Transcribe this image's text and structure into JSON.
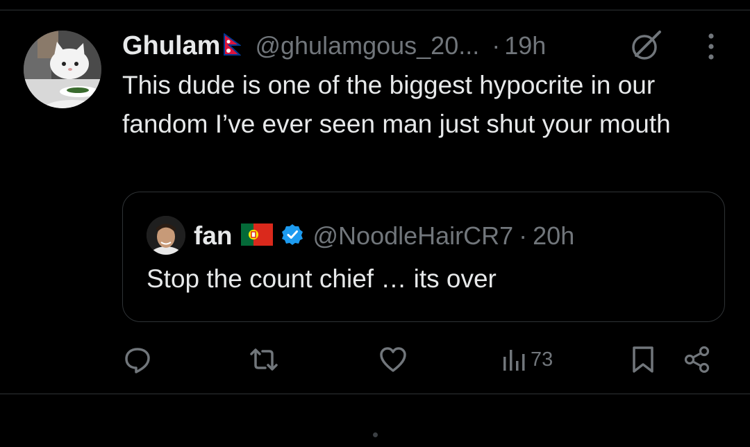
{
  "tweet": {
    "display_name": "Ghulam",
    "handle": "@ghulamgous_20...",
    "separator": "·",
    "timestamp": "19h",
    "text": "This dude is one of the biggest hypocrite in our fandom I’ve ever seen man just shut your mouth",
    "icons": {
      "flag": "nepal-flag-icon",
      "grok": "grok-icon",
      "more": "more-options-icon",
      "avatar": "cat-meme-avatar"
    }
  },
  "quoted_tweet": {
    "display_name": "fan",
    "handle": "@NoodleHairCR7",
    "separator": "·",
    "timestamp": "20h",
    "text": "Stop the count chief … its over",
    "icons": {
      "flag": "portugal-flag-icon",
      "verified": "verified-badge-icon",
      "avatar": "player-avatar"
    }
  },
  "actions": {
    "reply_icon": "reply-icon",
    "repost_icon": "repost-icon",
    "like_icon": "like-icon",
    "views_icon": "views-icon",
    "views_count": "73",
    "bookmark_icon": "bookmark-icon",
    "share_icon": "share-icon"
  },
  "colors": {
    "background": "#000000",
    "primary_text": "#e7e9ea",
    "secondary_text": "#71767b",
    "border": "#2f3336",
    "verified_blue": "#1d9bf0"
  }
}
